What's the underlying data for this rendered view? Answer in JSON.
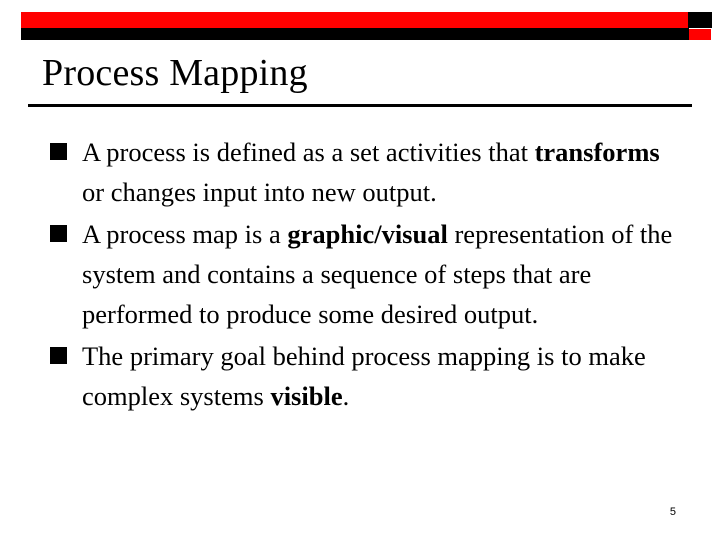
{
  "slide": {
    "title": "Process Mapping",
    "page_number": "5",
    "colors": {
      "accent_red": "#ff0000",
      "accent_black": "#000000",
      "background": "#ffffff",
      "text": "#000000"
    },
    "decoration": {
      "top_bar_icon": "red-black-banner",
      "red_bar_label": "red-accent-bar",
      "black_bar_label": "black-accent-bar",
      "red_square_label": "red-accent-square"
    },
    "bullets": [
      {
        "marker": "filled-square",
        "runs": [
          {
            "text": "A process is defined as a set activities that ",
            "bold": false
          },
          {
            "text": "transforms",
            "bold": true
          },
          {
            "text": " or changes input into new output.",
            "bold": false
          }
        ]
      },
      {
        "marker": "filled-square",
        "runs": [
          {
            "text": "A process map is a ",
            "bold": false
          },
          {
            "text": "graphic/visual",
            "bold": true
          },
          {
            "text": " representation of the system and contains a sequence of steps that are performed to produce some desired output.",
            "bold": false
          }
        ]
      },
      {
        "marker": "filled-square",
        "runs": [
          {
            "text": "The primary goal behind process mapping is to make complex systems ",
            "bold": false
          },
          {
            "text": "visible",
            "bold": true
          },
          {
            "text": ".",
            "bold": false
          }
        ]
      }
    ]
  }
}
